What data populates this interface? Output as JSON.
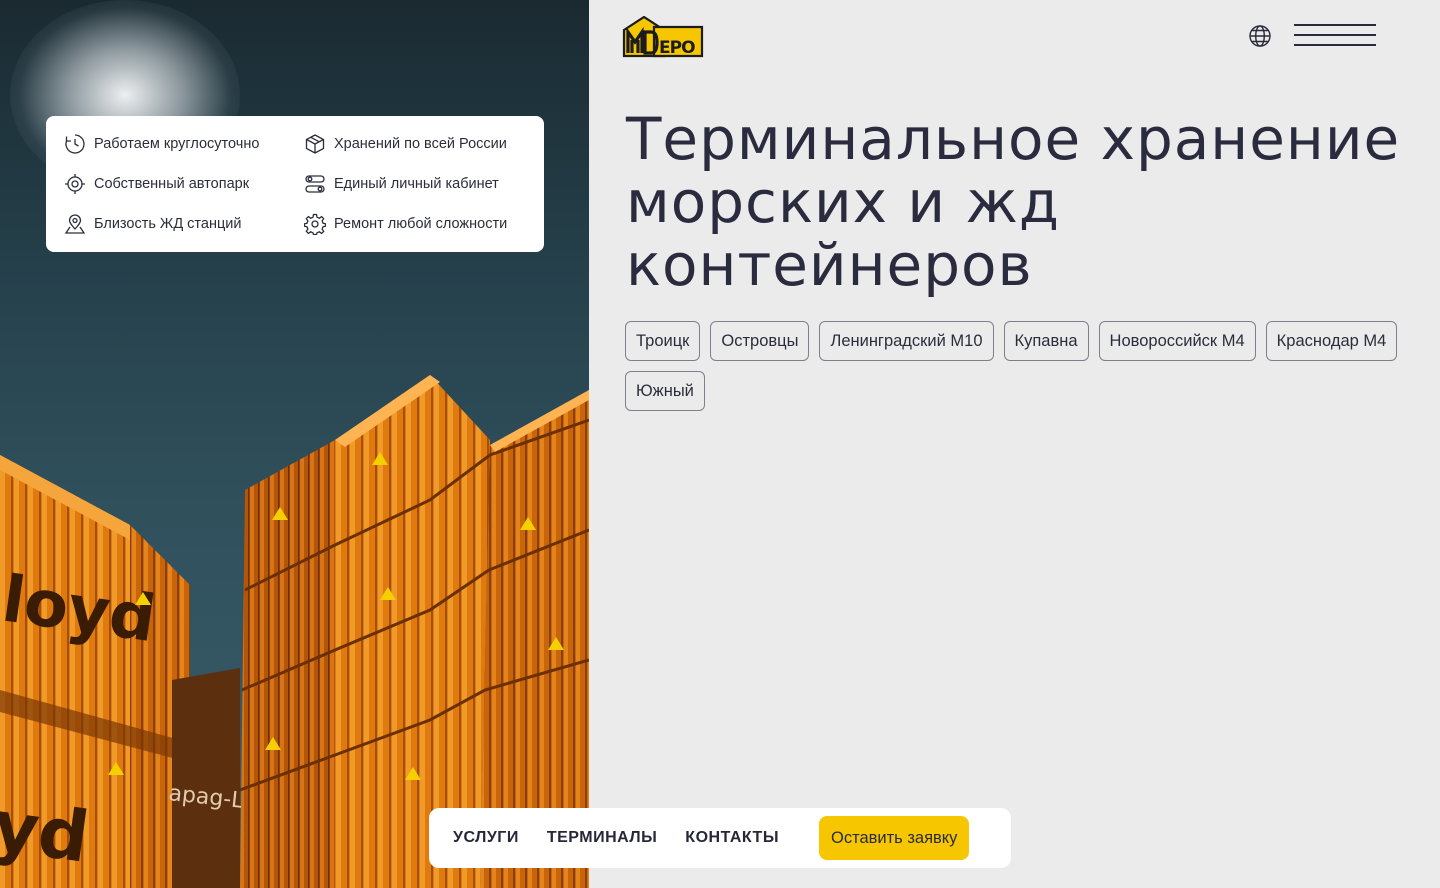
{
  "brand": {
    "logo_text": "MDEPO",
    "accent": "#f6c700"
  },
  "header": {
    "language_icon": "globe-icon",
    "menu_icon": "hamburger-menu-icon"
  },
  "features": [
    {
      "label": "Работаем круглосуточно",
      "icon": "clock-icon"
    },
    {
      "label": "Хранений по всей России",
      "icon": "box-icon"
    },
    {
      "label": "Собственный автопарк",
      "icon": "target-icon"
    },
    {
      "label": "Единый личный кабинет",
      "icon": "toggles-icon"
    },
    {
      "label": "Близость ЖД станций",
      "icon": "map-pin-icon"
    },
    {
      "label": "Ремонт любой сложности",
      "icon": "gear-icon"
    }
  ],
  "hero": {
    "title": "Терминальное хранение морских и жд контейнеров",
    "locations": [
      "Троицк",
      "Островцы",
      "Ленинградский М10",
      "Купавна",
      "Новороссийск М4",
      "Краснодар М4",
      "Южный"
    ]
  },
  "nav": {
    "links": [
      "УСЛУГИ",
      "ТЕРМИНАЛЫ",
      "КОНТАКТЫ"
    ],
    "cta_label": "Оставить заявку"
  }
}
